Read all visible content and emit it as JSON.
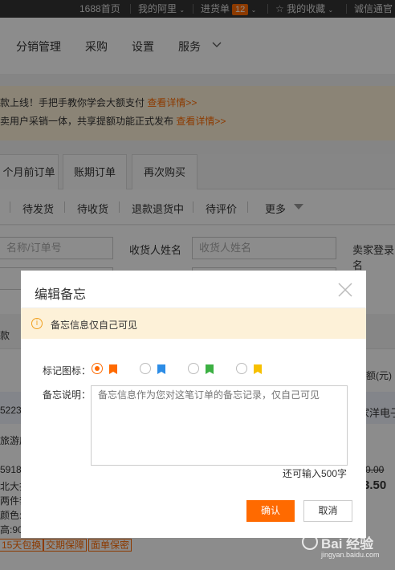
{
  "topbar": {
    "items": [
      "1688首页",
      "我的阿里",
      "进货单",
      "我的收藏",
      "诚信通官"
    ],
    "cart_count": "12"
  },
  "nav": {
    "items": [
      "分销管理",
      "采购",
      "设置",
      "服务"
    ]
  },
  "notice": {
    "line1_text": "款上线！手把手教你学会大额支付",
    "line1_link": "查看详情>>",
    "line2_text": "卖用户采销一体，共享提额功能正式发布",
    "line2_link": "查看详情>>"
  },
  "tabs": [
    "个月前订单",
    "账期订单",
    "再次购买"
  ],
  "status_tabs": [
    "待发货",
    "待收货",
    "退款退货中",
    "待评价",
    "更多"
  ],
  "filters": {
    "product_placeholder": "名称/订单号",
    "receiver_label": "收货人姓名",
    "receiver_placeholder": "收货人姓名",
    "seller_label": "卖家登录名"
  },
  "background_table": {
    "col_qty": "款",
    "col_amount": "额(元)",
    "order_no": "5223",
    "seller": "家洋电子",
    "shop": "旅游店",
    "item_lines": [
      "5918",
      "北大排",
      "两件套",
      "颜色:5",
      "高:90"
    ],
    "price_old": "0.00",
    "price_new": "3.50",
    "tags": [
      "15天包换",
      "交期保障",
      "面单保密"
    ]
  },
  "dialog": {
    "title": "编辑备忘",
    "tip": "备忘信息仅自己可见",
    "flag_label": "标记图标：",
    "memo_label": "备忘说明：",
    "memo_placeholder": "备忘信息作为您对这笔订单的备忘记录，仅自己可见",
    "counter": "还可输入500字",
    "confirm": "确认",
    "cancel": "取消",
    "flags": [
      {
        "color": "#ff6a00",
        "selected": true
      },
      {
        "color": "#2c8ce6",
        "selected": false
      },
      {
        "color": "#3cb043",
        "selected": false
      },
      {
        "color": "#f7c000",
        "selected": false
      }
    ]
  },
  "watermark": {
    "main": "Bai 经验",
    "sub": "jingyan.baidu.com"
  },
  "colors": {
    "accent": "#ff6a00",
    "overlay": "rgba(0,0,0,0.45)"
  }
}
